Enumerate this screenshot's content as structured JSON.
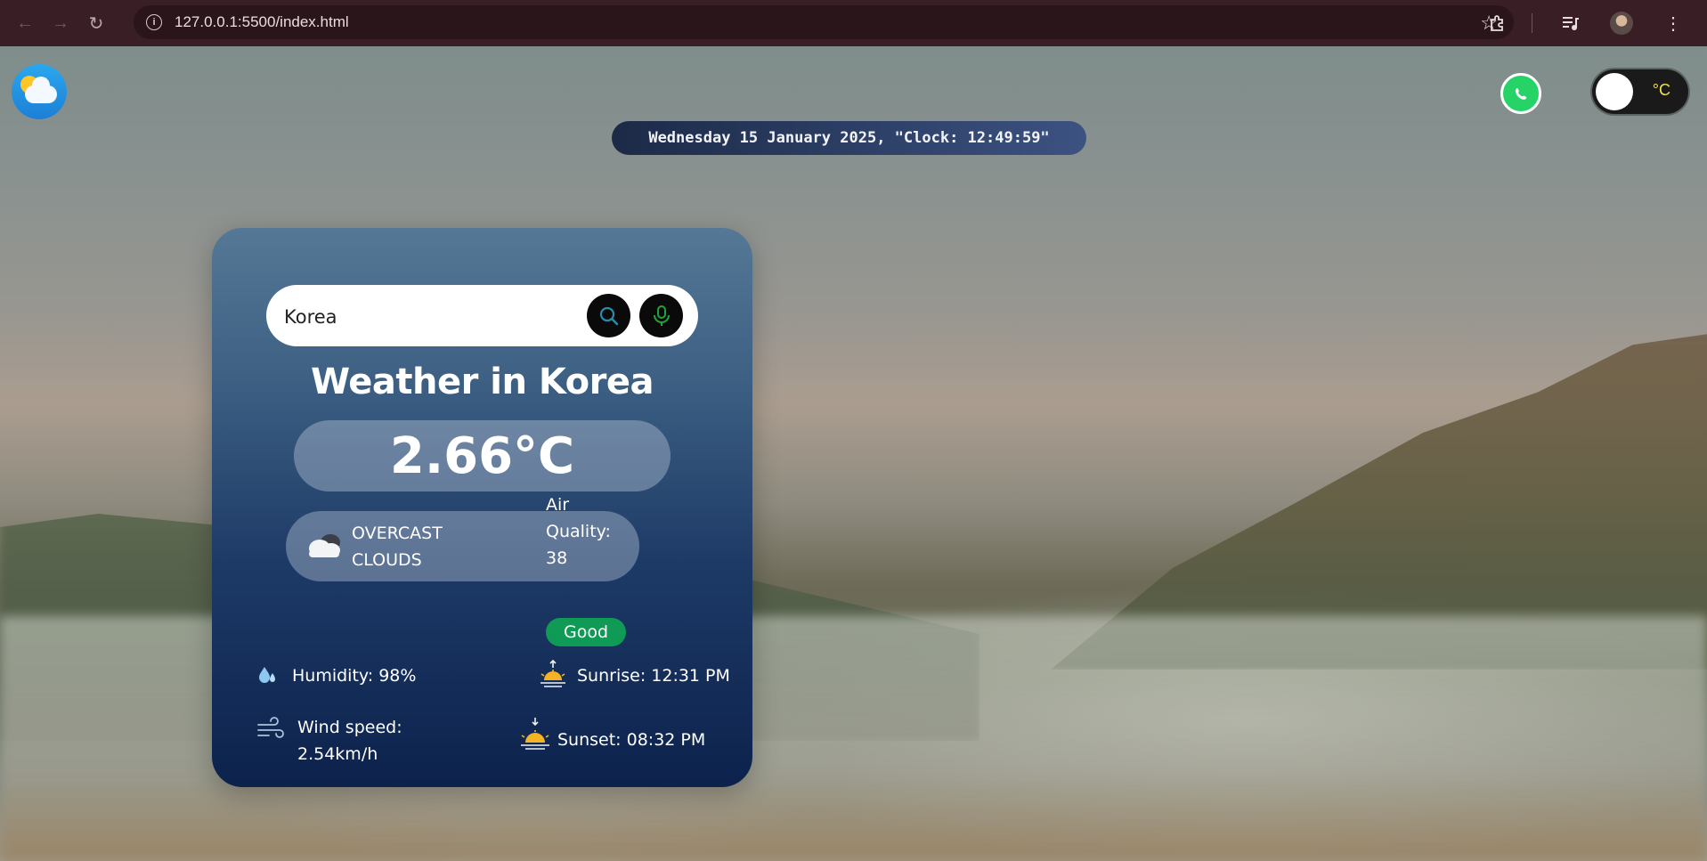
{
  "browser": {
    "url": "127.0.0.1:5500/index.html"
  },
  "header": {
    "clock_text": "Wednesday 15 January 2025, \"Clock: 12:49:59\"",
    "unit_toggle_label": "°C"
  },
  "search": {
    "value": "Korea",
    "placeholder": ""
  },
  "weather": {
    "title": "Weather in Korea",
    "temperature": "2.66°C",
    "condition": "OVERCAST CLOUDS",
    "air_quality_label": "Air Quality: 38",
    "air_quality_status": "Good",
    "humidity": "Humidity: 98%",
    "wind_speed": "Wind speed: 2.54km/h",
    "sunrise": "Sunrise: 12:31 PM",
    "sunset": "Sunset: 08:32 PM"
  },
  "colors": {
    "air_quality_good": "#0f9a55",
    "toggle_unit": "#f2e24a",
    "whatsapp": "#25d366"
  },
  "icons": [
    "back-icon",
    "forward-icon",
    "reload-icon",
    "site-info-icon",
    "bookmark-star-icon",
    "extensions-icon",
    "media-icon",
    "profile-avatar",
    "menu-icon",
    "weather-logo-icon",
    "whatsapp-icon",
    "search-icon",
    "microphone-icon",
    "cloud-icon",
    "humidity-icon",
    "wind-icon",
    "sunrise-icon",
    "sunset-icon"
  ]
}
